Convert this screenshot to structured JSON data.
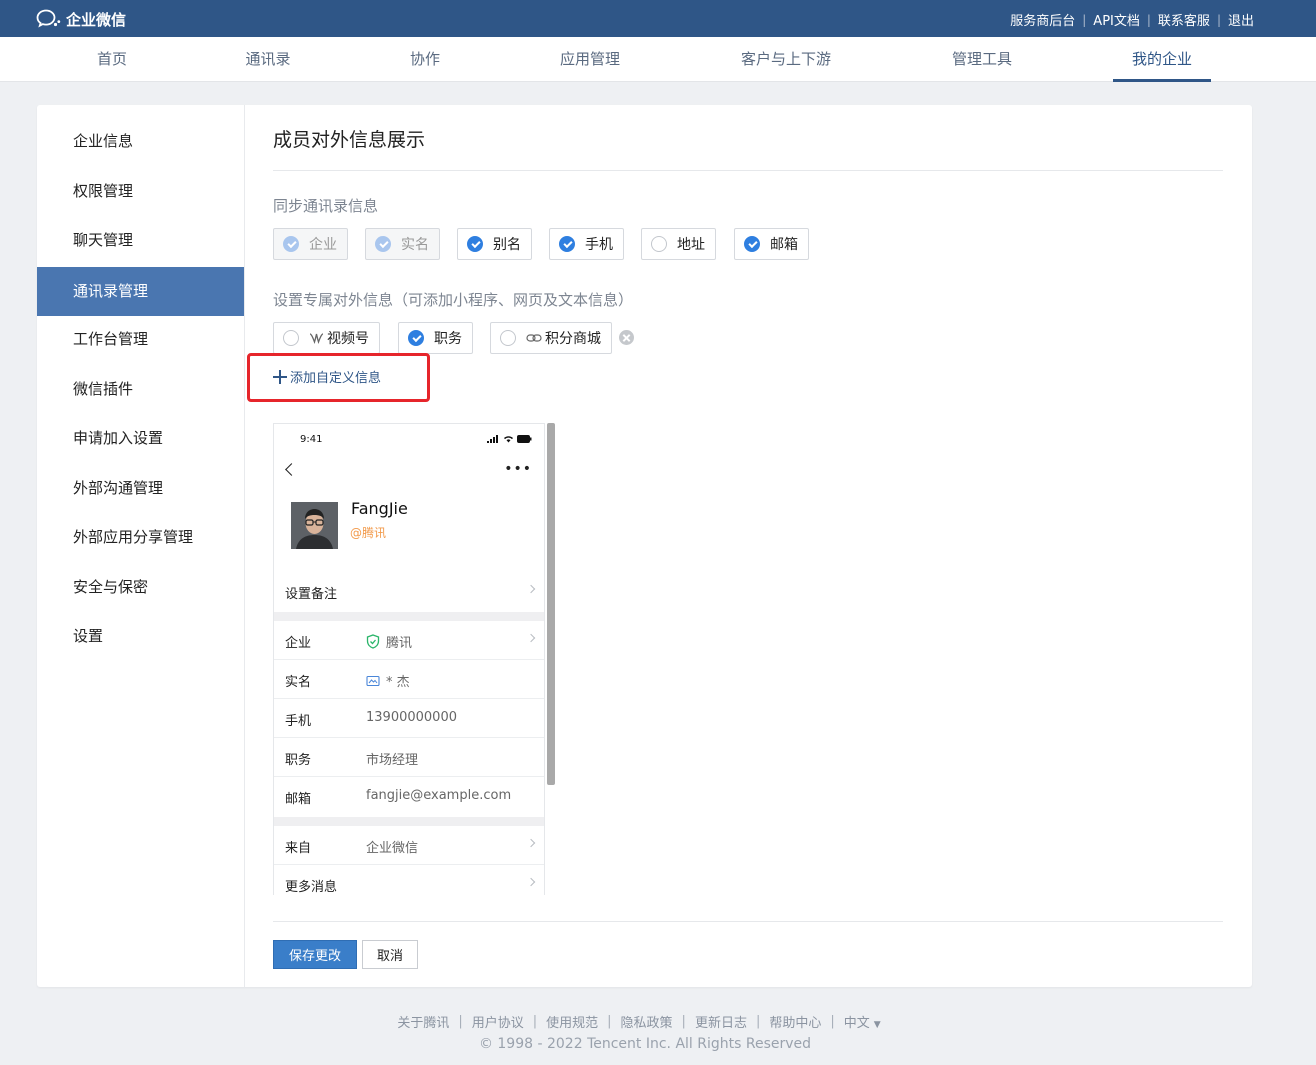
{
  "app": {
    "logo_text": "企业微信"
  },
  "top_links": [
    "服务商后台",
    "API文档",
    "联系客服",
    "退出"
  ],
  "main_nav": [
    "首页",
    "通讯录",
    "协作",
    "应用管理",
    "客户与上下游",
    "管理工具",
    "我的企业"
  ],
  "main_nav_active": "我的企业",
  "sidebar": {
    "items": [
      "企业信息",
      "权限管理",
      "聊天管理",
      "通讯录管理",
      "工作台管理",
      "微信插件",
      "申请加入设置",
      "外部沟通管理",
      "外部应用分享管理",
      "安全与保密",
      "设置"
    ],
    "active": "通讯录管理"
  },
  "page": {
    "title": "成员对外信息展示",
    "sync_label": "同步通讯录信息",
    "sync_options": [
      {
        "label": "企业",
        "state": "checked-disabled"
      },
      {
        "label": "实名",
        "state": "checked-disabled"
      },
      {
        "label": "别名",
        "state": "checked"
      },
      {
        "label": "手机",
        "state": "checked"
      },
      {
        "label": "地址",
        "state": "unchecked"
      },
      {
        "label": "邮箱",
        "state": "checked"
      }
    ],
    "custom_label": "设置专属对外信息（可添加小程序、网页及文本信息）",
    "custom_options": [
      {
        "label": "视频号",
        "state": "unchecked",
        "icon": "channels-icon"
      },
      {
        "label": "职务",
        "state": "checked",
        "icon": ""
      },
      {
        "label": "积分商城",
        "state": "unchecked",
        "icon": "link-icon"
      }
    ],
    "add_custom": "添加自定义信息",
    "save_button": "保存更改",
    "cancel_button": "取消"
  },
  "preview": {
    "status_time": "9:41",
    "name": "FangJie",
    "corp": "@腾讯",
    "remark_row": "设置备注",
    "rows": [
      {
        "key": "企业",
        "value": "腾讯",
        "icon": "verified-shield-icon",
        "arrow": true
      },
      {
        "key": "实名",
        "value": "* 杰",
        "icon": "id-card-icon",
        "arrow": false
      },
      {
        "key": "手机",
        "value": "13900000000",
        "icon": "",
        "arrow": false
      },
      {
        "key": "职务",
        "value": "市场经理",
        "icon": "",
        "arrow": false
      },
      {
        "key": "邮箱",
        "value": "fangjie@example.com",
        "icon": "",
        "arrow": false
      }
    ],
    "bottom_rows": [
      {
        "key": "来自",
        "value": "企业微信",
        "arrow": true
      },
      {
        "key": "更多消息",
        "value": "",
        "arrow": true
      }
    ]
  },
  "footer": {
    "links": [
      "关于腾讯",
      "用户协议",
      "使用规范",
      "隐私政策",
      "更新日志",
      "帮助中心",
      "中文"
    ],
    "copyright": "© 1998 - 2022 Tencent Inc. All Rights Reserved"
  },
  "colors": {
    "topbar": "#2f5687",
    "sidebar_active": "#4a76b0",
    "checked": "#2f7fe0",
    "primary_button": "#3a7ec9",
    "highlight": "#e6252b",
    "corp_orange": "#f29a4b"
  }
}
